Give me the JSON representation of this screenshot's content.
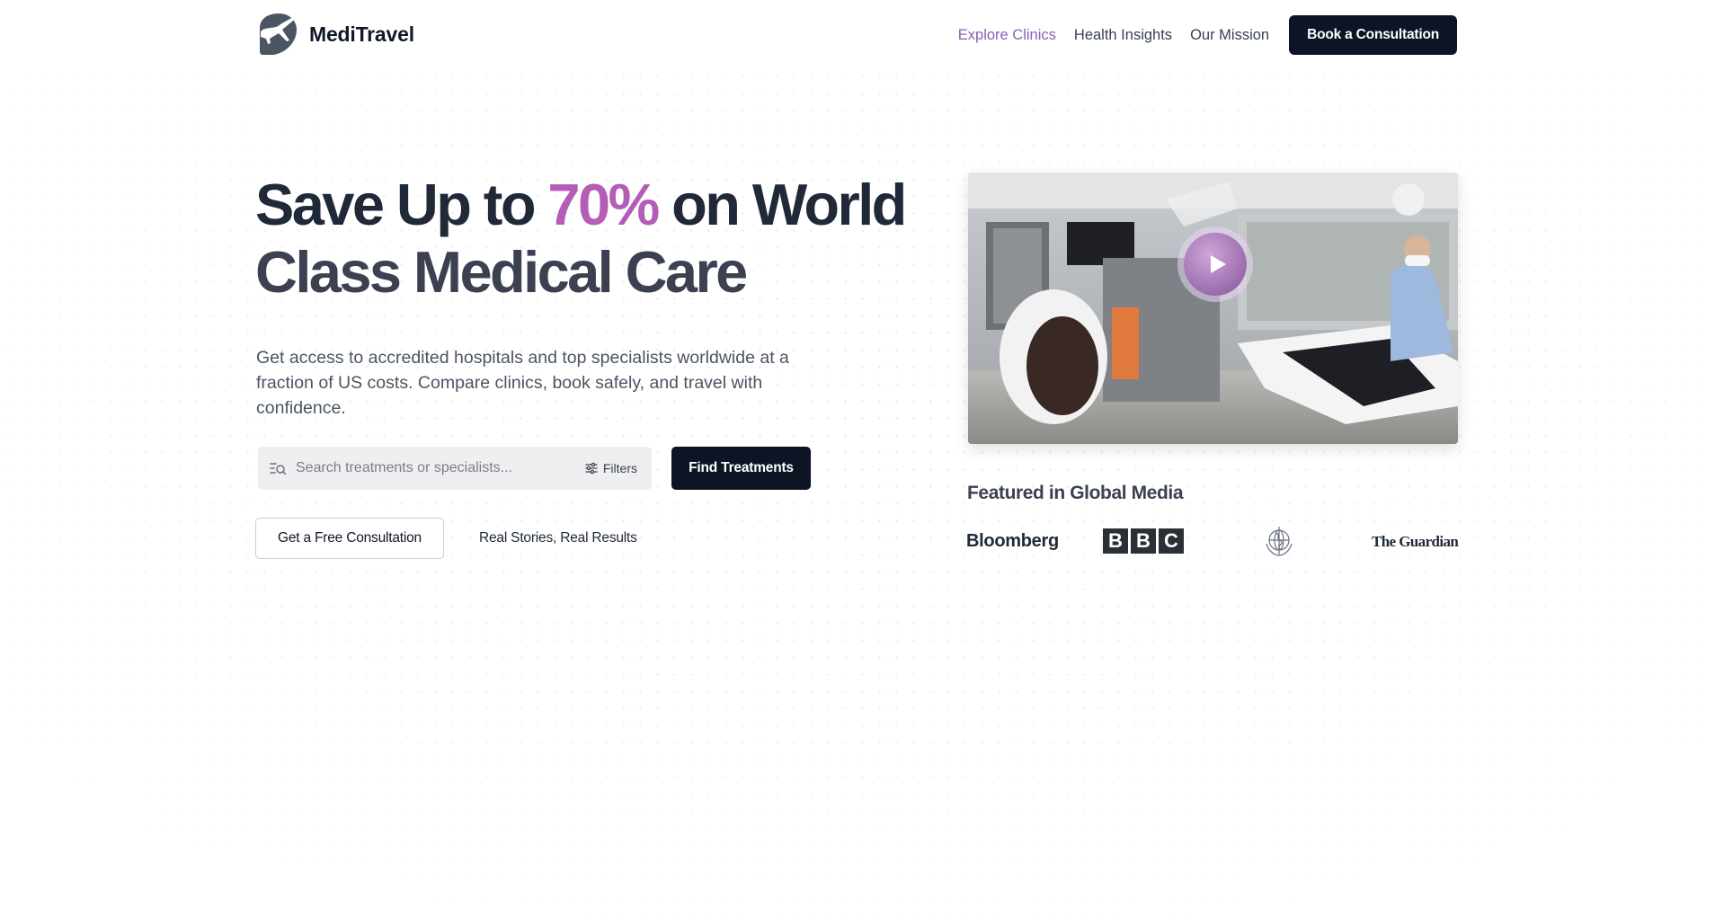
{
  "header": {
    "brand": "MediTravel",
    "nav": [
      {
        "label": "Explore Clinics",
        "active": true
      },
      {
        "label": "Health Insights",
        "active": false
      },
      {
        "label": "Our Mission",
        "active": false
      }
    ],
    "cta_label": "Book a Consultation"
  },
  "hero": {
    "title_part1": "Save Up to ",
    "title_accent": "70%",
    "title_part2": " on World",
    "title_line2": "Class Medical Care",
    "subtitle": "Get access to accredited hospitals and top specialists worldwide at a fraction of US costs. Compare clinics, book safely, and travel with confidence.",
    "search": {
      "placeholder": "Search treatments or specialists...",
      "value": "",
      "filters_label": "Filters"
    },
    "find_button_label": "Find Treatments",
    "consult_button_label": "Get a Free Consultation",
    "stories_link_label": "Real Stories, Real Results"
  },
  "video": {
    "play_icon": "play-icon"
  },
  "media": {
    "title": "Featured in Global Media",
    "logos": {
      "bloomberg": "Bloomberg",
      "bbc": [
        "B",
        "B",
        "C"
      ],
      "who_icon": "who-emblem-icon",
      "guardian": "The Guardian"
    }
  },
  "colors": {
    "accent": "#b45db7",
    "nav_active": "#8a5fb7",
    "dark_button": "#0d1525",
    "title": "#1f2937"
  }
}
